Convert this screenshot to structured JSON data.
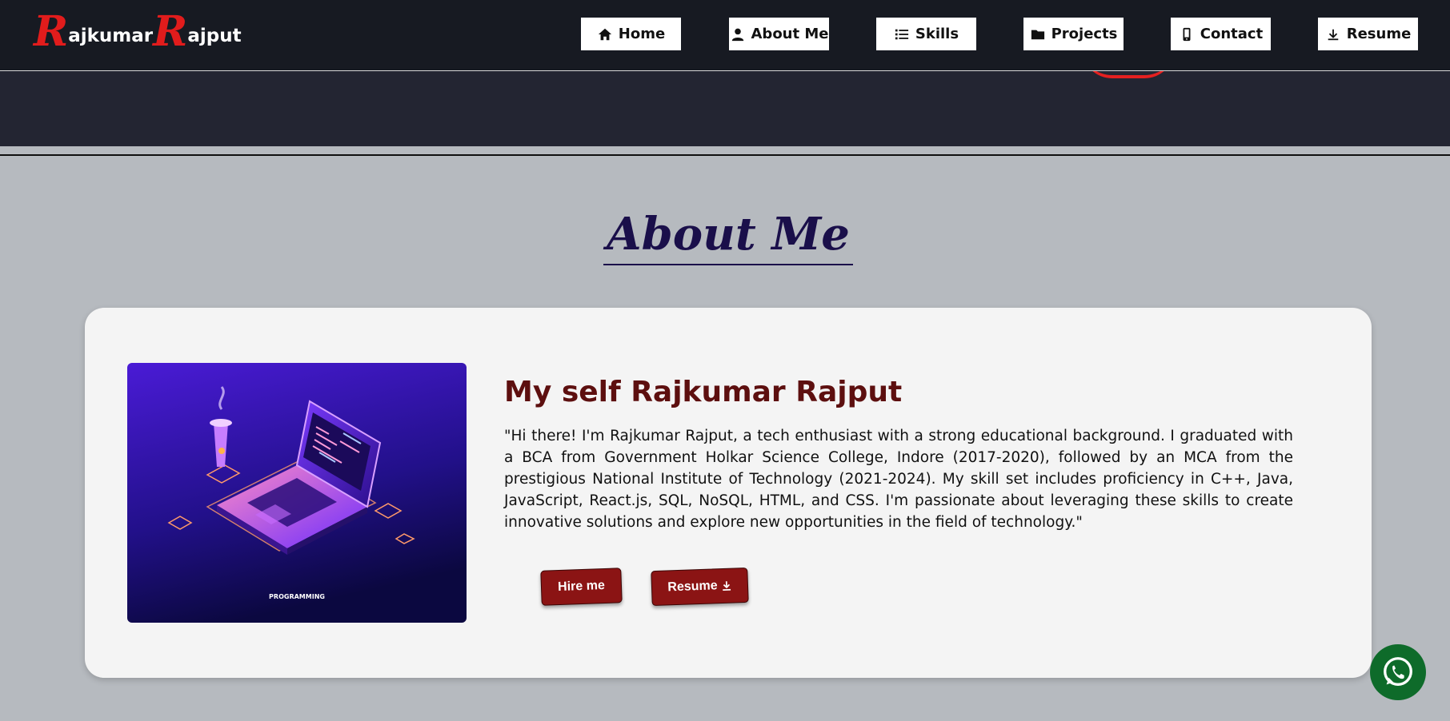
{
  "brand": {
    "first_initial": "R",
    "first_rest": "ajkumar",
    "last_initial": "R",
    "last_rest": "ajput"
  },
  "nav": {
    "items": [
      {
        "label": "Home",
        "icon": "home-icon"
      },
      {
        "label": "About Me",
        "icon": "user-icon"
      },
      {
        "label": "Skills",
        "icon": "list-icon"
      },
      {
        "label": "Projects",
        "icon": "folder-icon"
      },
      {
        "label": "Contact",
        "icon": "phone-icon"
      },
      {
        "label": "Resume",
        "icon": "download-icon"
      }
    ]
  },
  "about": {
    "section_title": "About Me",
    "heading": "My self Rajkumar Rajput",
    "bio": "\"Hi there! I'm Rajkumar Rajput, a tech enthusiast with a strong educational background. I graduated with a BCA from Government Holkar Science College, Indore (2017-2020), followed by an MCA from the prestigious National Institute of Technology (2021-2024). My skill set includes proficiency in C++, Java, JavaScript, React.js, SQL, NoSQL, HTML, and CSS. I'm passionate about leveraging these skills to create innovative solutions and explore new opportunities in the field of technology.\"",
    "image_caption": "PROGRAMMING",
    "hire_label": "Hire me",
    "resume_label": "Resume"
  },
  "colors": {
    "nav_bg": "#171a22",
    "accent_red": "#e11c1c",
    "button_red": "#8b1414",
    "heading_maroon": "#5d0f0f",
    "title_navy": "#1a0f4a",
    "whatsapp_green": "#0e6b2a"
  },
  "floating": {
    "icon": "whatsapp-icon"
  }
}
